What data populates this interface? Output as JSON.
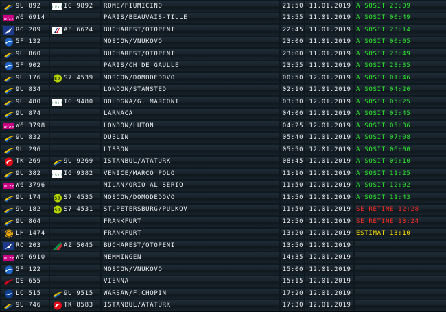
{
  "colors": {
    "status_green": "#2bea2b",
    "status_red": "#ff2a22",
    "status_yellow": "#ffe100",
    "text": "#e8ecef"
  },
  "flights": [
    {
      "logo": "blue-air-logo",
      "flight": "9U 892",
      "cs_logo": "alitalia-logo",
      "codeshare": "IG 9892",
      "destination": "ROME/FIUMICINO",
      "time": "21:50",
      "date": "11.01.2019",
      "status": "A SOSIT 23:09",
      "status_color": "green"
    },
    {
      "logo": "wizz-air-logo",
      "flight": "W6 6914",
      "cs_logo": "",
      "codeshare": "",
      "destination": "PARIS/BEAUVAIS-TILLE",
      "time": "21:55",
      "date": "11.01.2019",
      "status": "A SOSIT 00:49",
      "status_color": "green"
    },
    {
      "logo": "tarom-logo",
      "flight": "RO 209",
      "cs_logo": "air-france-logo",
      "codeshare": "AF 6624",
      "destination": "BUCHAREST/OTOPENI",
      "time": "22:45",
      "date": "11.01.2019",
      "status": "A SOSIT 23:14",
      "status_color": "green"
    },
    {
      "logo": "rossiya-logo",
      "flight": "5F 132",
      "cs_logo": "",
      "codeshare": "",
      "destination": "MOSCOW/VNUKOVO",
      "time": "23:00",
      "date": "11.01.2019",
      "status": "A SOSIT 00:05",
      "status_color": "green"
    },
    {
      "logo": "blue-air-logo",
      "flight": "9U 860",
      "cs_logo": "",
      "codeshare": "",
      "destination": "BUCHAREST/OTOPENI",
      "time": "23:00",
      "date": "11.01.2019",
      "status": "A SOSIT 23:49",
      "status_color": "green"
    },
    {
      "logo": "rossiya-logo",
      "flight": "5F 902",
      "cs_logo": "",
      "codeshare": "",
      "destination": "PARIS/CH DE GAULLE",
      "time": "23:55",
      "date": "11.01.2019",
      "status": "A SOSIT 23:35",
      "status_color": "green"
    },
    {
      "logo": "blue-air-logo",
      "flight": "9U 176",
      "cs_logo": "s7-logo",
      "codeshare": "S7 4539",
      "destination": "MOSCOW/DOMODEDOVO",
      "time": "00:50",
      "date": "12.01.2019",
      "status": "A SOSIT 01:46",
      "status_color": "green"
    },
    {
      "logo": "blue-air-logo",
      "flight": "9U 834",
      "cs_logo": "",
      "codeshare": "",
      "destination": "LONDON/STANSTED",
      "time": "02:10",
      "date": "12.01.2019",
      "status": "A SOSIT 04:20",
      "status_color": "green"
    },
    {
      "logo": "blue-air-logo",
      "flight": "9U 480",
      "cs_logo": "alitalia-logo",
      "codeshare": "IG 9480",
      "destination": "BOLOGNA/G. MARCONI",
      "time": "03:30",
      "date": "12.01.2019",
      "status": "A SOSIT 05:25",
      "status_color": "green"
    },
    {
      "logo": "blue-air-logo",
      "flight": "9U 874",
      "cs_logo": "",
      "codeshare": "",
      "destination": "LARNACA",
      "time": "04:00",
      "date": "12.01.2019",
      "status": "A SOSIT 05:45",
      "status_color": "green"
    },
    {
      "logo": "wizz-air-logo",
      "flight": "W6 3798",
      "cs_logo": "",
      "codeshare": "",
      "destination": "LONDON/LUTON",
      "time": "04:25",
      "date": "12.01.2019",
      "status": "A SOSIT 05:36",
      "status_color": "green"
    },
    {
      "logo": "blue-air-logo",
      "flight": "9U 832",
      "cs_logo": "",
      "codeshare": "",
      "destination": "DUBLIN",
      "time": "05:40",
      "date": "12.01.2019",
      "status": "A SOSIT 07:08",
      "status_color": "green"
    },
    {
      "logo": "blue-air-logo",
      "flight": "9U 296",
      "cs_logo": "",
      "codeshare": "",
      "destination": "LISBON",
      "time": "05:50",
      "date": "12.01.2019",
      "status": "A SOSIT 06:00",
      "status_color": "green"
    },
    {
      "logo": "turkish-logo",
      "flight": "TK 269",
      "cs_logo": "blue-air-logo",
      "codeshare": "9U 9269",
      "destination": "ISTANBUL/ATATURK",
      "time": "08:45",
      "date": "12.01.2019",
      "status": "A SOSIT 09:10",
      "status_color": "green"
    },
    {
      "logo": "blue-air-logo",
      "flight": "9U 382",
      "cs_logo": "alitalia-logo",
      "codeshare": "IG 9382",
      "destination": "VENICE/MARCO POLO",
      "time": "11:10",
      "date": "12.01.2019",
      "status": "A SOSIT 11:25",
      "status_color": "green"
    },
    {
      "logo": "wizz-air-logo",
      "flight": "W6 3796",
      "cs_logo": "",
      "codeshare": "",
      "destination": "MILAN/ORIO AL SERIO",
      "time": "11:50",
      "date": "12.01.2019",
      "status": "A SOSIT 12:02",
      "status_color": "green"
    },
    {
      "logo": "blue-air-logo",
      "flight": "9U 174",
      "cs_logo": "s7-logo",
      "codeshare": "S7 4535",
      "destination": "MOSCOW/DOMODEDOVO",
      "time": "11:50",
      "date": "12.01.2019",
      "status": "A SOSIT 11:43",
      "status_color": "green"
    },
    {
      "logo": "blue-air-logo",
      "flight": "9U 182",
      "cs_logo": "s7-logo",
      "codeshare": "S7 4531",
      "destination": "ST.PETERSBURG/PULKOV",
      "time": "11:50",
      "date": "12.01.2019",
      "status": "SE RETINE 12:28",
      "status_color": "red"
    },
    {
      "logo": "blue-air-logo",
      "flight": "9U 864",
      "cs_logo": "",
      "codeshare": "",
      "destination": "FRANKFURT",
      "time": "12:50",
      "date": "12.01.2019",
      "status": "SE RETINE 13:24",
      "status_color": "red"
    },
    {
      "logo": "lufthansa-logo",
      "flight": "LH 1474",
      "cs_logo": "",
      "codeshare": "",
      "destination": "FRANKFURT",
      "time": "13:20",
      "date": "12.01.2019",
      "status": "ESTIMAT 13:10",
      "status_color": "yellow"
    },
    {
      "logo": "tarom-logo",
      "flight": "RO 203",
      "cs_logo": "alitalia-tail-logo",
      "codeshare": "AZ 5045",
      "destination": "BUCHAREST/OTOPENI",
      "time": "13:50",
      "date": "12.01.2019",
      "status": "",
      "status_color": "green"
    },
    {
      "logo": "wizz-air-logo",
      "flight": "W6 6910",
      "cs_logo": "",
      "codeshare": "",
      "destination": "MEMMINGEN",
      "time": "14:35",
      "date": "12.01.2019",
      "status": "",
      "status_color": "green"
    },
    {
      "logo": "rossiya-logo",
      "flight": "5F 122",
      "cs_logo": "",
      "codeshare": "",
      "destination": "MOSCOW/VNUKOVO",
      "time": "15:00",
      "date": "12.01.2019",
      "status": "",
      "status_color": "green"
    },
    {
      "logo": "austrian-logo",
      "flight": "OS 655",
      "cs_logo": "",
      "codeshare": "",
      "destination": "VIENNA",
      "time": "15:15",
      "date": "12.01.2019",
      "status": "",
      "status_color": "green"
    },
    {
      "logo": "lot-logo",
      "flight": "LO 515",
      "cs_logo": "blue-air-logo",
      "codeshare": "9U 9515",
      "destination": "WARSAW/F.CHOPIN",
      "time": "17:20",
      "date": "12.01.2019",
      "status": "",
      "status_color": "green"
    },
    {
      "logo": "blue-air-logo",
      "flight": "9U 746",
      "cs_logo": "turkish-logo",
      "codeshare": "TK 8583",
      "destination": "ISTANBUL/ATATURK",
      "time": "17:30",
      "date": "12.01.2019",
      "status": "",
      "status_color": "green"
    }
  ]
}
